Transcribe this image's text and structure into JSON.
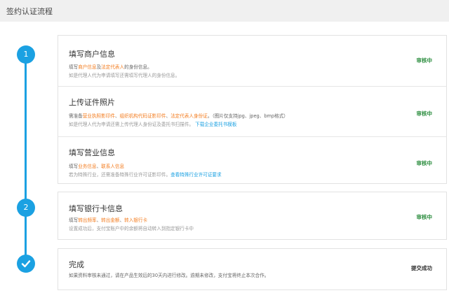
{
  "header": {
    "title": "签约认证流程"
  },
  "nodes": [
    {
      "label": "1",
      "kind": "number"
    },
    {
      "label": "2",
      "kind": "number"
    },
    {
      "label": "",
      "kind": "check",
      "icon": "check-icon"
    }
  ],
  "colors": {
    "accent": "#1ba1e2",
    "highlight": "#f37b1d",
    "status_green": "#2a8c3d"
  },
  "step1": {
    "merchant": {
      "title": "填写商户信息",
      "line1": {
        "p1": "填写",
        "h1": "商户信息",
        "p2": "及",
        "h2": "法定代表人",
        "p3": "的身份信息。"
      },
      "line2": "如是代理人代为申请填写还需填写代理人的身份信息。",
      "status": "审核中"
    },
    "upload": {
      "title": "上传证件照片",
      "line1": {
        "p1": "需准备",
        "h1": "营业执照影印件",
        "p2": "、",
        "h2": "组织机构代码证影印件",
        "p3": "、",
        "h3": "法定代表人身份证",
        "p4": "。（图片仅支持jpg、jpeg、bmp格式）"
      },
      "line2": {
        "p1": "如是代理人代为申请还需上传代理人身份证及委托书扫描件。",
        "link": "下载企业委托书模板"
      },
      "status": "审核中"
    },
    "business": {
      "title": "填写营业信息",
      "line1": {
        "p1": "填写",
        "h1": "业务信息",
        "p2": "、",
        "h2": "联系人信息"
      },
      "line2": {
        "p1": "若为特殊行业，还需准备特殊行业许可证影印件。",
        "link": "查看特殊行业许可证要求"
      },
      "status": "审核中"
    }
  },
  "step2": {
    "bank": {
      "title": "填写银行卡信息",
      "line1": {
        "p1": "填写",
        "h1": "转出频率",
        "p2": "、",
        "h2": "转出金额",
        "p3": "、",
        "h3": "转入银行卡"
      },
      "line2": "设置成功后，支付宝账户中的余额将自动转入到指定银行卡中",
      "status": "审核中"
    }
  },
  "step3": {
    "done": {
      "title": "完成",
      "line1": "如果资料审核未通过，请在产品生效后的30天内进行修改。逾期未修改，支付宝将终止本次合作。",
      "status": "提交成功"
    }
  }
}
